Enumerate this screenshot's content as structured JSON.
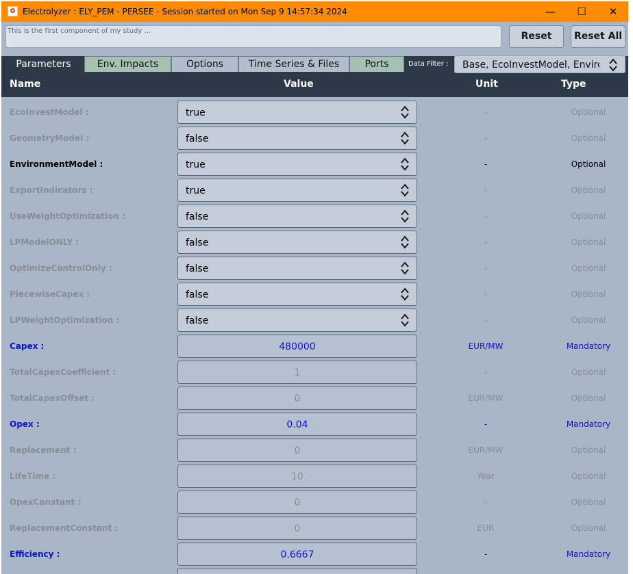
{
  "window": {
    "title": "Electrolyzer : ELY_PEM - PERSEE - Session started on Mon Sep  9 14:57:34 2024",
    "minimize": "—",
    "maximize": "☐",
    "close": "✕"
  },
  "comment": {
    "placeholder": "This is the first component of my study ..."
  },
  "buttons": {
    "reset": "Reset",
    "reset_all": "Reset All"
  },
  "tabs": [
    {
      "label": "Parameters"
    },
    {
      "label": "Env. Impacts"
    },
    {
      "label": "Options"
    },
    {
      "label": "Time Series & Files"
    },
    {
      "label": "Ports"
    }
  ],
  "filter": {
    "label": "Data Filter :",
    "value": "Base, EcoInvestModel, EnvironmentModel"
  },
  "columns": {
    "name": "Name",
    "value": "Value",
    "unit": "Unit",
    "type": "Type"
  },
  "colors": {
    "title_bar": "#ff8c00",
    "header_bar": "#2e3948",
    "mandatory": "#0a14d9",
    "disabled": "#878e98"
  },
  "rows": [
    {
      "name": "EcoInvestModel :",
      "value": "true",
      "unit": "-",
      "type": "Optional"
    },
    {
      "name": "GeometryModel :",
      "value": "false",
      "unit": "-",
      "type": "Optional"
    },
    {
      "name": "EnvironmentModel :",
      "value": "true",
      "unit": "-",
      "type": "Optional"
    },
    {
      "name": "ExportIndicators :",
      "value": "true",
      "unit": "-",
      "type": "Optional"
    },
    {
      "name": "UseWeightOptimization :",
      "value": "false",
      "unit": "-",
      "type": "Optional"
    },
    {
      "name": "LPModelONLY :",
      "value": "false",
      "unit": "-",
      "type": "Optional"
    },
    {
      "name": "OptimizeControlOnly :",
      "value": "false",
      "unit": "-",
      "type": "Optional"
    },
    {
      "name": "PiecewiseCapex :",
      "value": "false",
      "unit": "-",
      "type": "Optional"
    },
    {
      "name": "LPWeightOptimization :",
      "value": "false",
      "unit": "-",
      "type": "Optional"
    },
    {
      "name": "Capex :",
      "value": "480000",
      "unit": "EUR/MW",
      "type": "Mandatory"
    },
    {
      "name": "TotalCapexCoefficient :",
      "value": "1",
      "unit": "-",
      "type": "Optional"
    },
    {
      "name": "TotalCapexOffset :",
      "value": "0",
      "unit": "EUR/MW",
      "type": "Optional"
    },
    {
      "name": "Opex :",
      "value": "0.04",
      "unit": "-",
      "type": "Mandatory"
    },
    {
      "name": "Replacement :",
      "value": "0",
      "unit": "EUR/MW",
      "type": "Optional"
    },
    {
      "name": "LifeTime :",
      "value": "10",
      "unit": "Year",
      "type": "Optional"
    },
    {
      "name": "OpexConstant :",
      "value": "0",
      "unit": "-",
      "type": "Optional"
    },
    {
      "name": "ReplacementConstant :",
      "value": "0",
      "unit": "EUR",
      "type": "Optional"
    },
    {
      "name": "Efficiency :",
      "value": "0.6667",
      "unit": "-",
      "type": "Mandatory"
    }
  ]
}
